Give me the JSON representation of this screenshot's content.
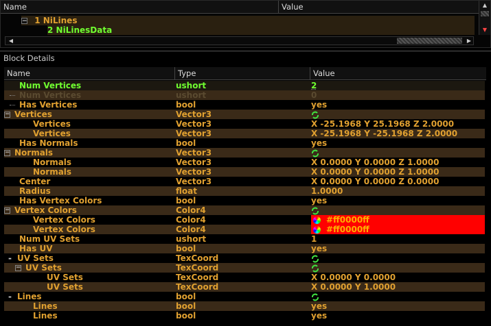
{
  "tree": {
    "header": {
      "name_col": "Name",
      "value_col": "Value"
    },
    "rows": [
      {
        "label": "1 NiLines"
      },
      {
        "label": "2 NiLinesData"
      }
    ]
  },
  "block_details": {
    "title": "Block Details",
    "columns": {
      "name": "Name",
      "type": "Type",
      "value": "Value"
    },
    "rows": [
      {
        "name": "Num Vertices",
        "type": "ushort",
        "value": "2"
      },
      {
        "name": "Num Vertices",
        "type": "ushort",
        "value": "0"
      },
      {
        "name": "Has Vertices",
        "type": "bool",
        "value": "yes"
      },
      {
        "name": "Vertices",
        "type": "Vector3",
        "value": ""
      },
      {
        "name": "Vertices",
        "type": "Vector3",
        "value": "X -25.1968 Y 25.1968 Z 2.0000"
      },
      {
        "name": "Vertices",
        "type": "Vector3",
        "value": "X -25.1968 Y -25.1968 Z 2.0000"
      },
      {
        "name": "Has Normals",
        "type": "bool",
        "value": "yes"
      },
      {
        "name": "Normals",
        "type": "Vector3",
        "value": ""
      },
      {
        "name": "Normals",
        "type": "Vector3",
        "value": "X 0.0000 Y 0.0000 Z 1.0000"
      },
      {
        "name": "Normals",
        "type": "Vector3",
        "value": "X 0.0000 Y 0.0000 Z 1.0000"
      },
      {
        "name": "Center",
        "type": "Vector3",
        "value": "X 0.0000 Y 0.0000 Z 0.0000"
      },
      {
        "name": "Radius",
        "type": "float",
        "value": "1.0000"
      },
      {
        "name": "Has Vertex Colors",
        "type": "bool",
        "value": "yes"
      },
      {
        "name": "Vertex Colors",
        "type": "Color4",
        "value": ""
      },
      {
        "name": "Vertex Colors",
        "type": "Color4",
        "value": "#ff0000ff"
      },
      {
        "name": "Vertex Colors",
        "type": "Color4",
        "value": "#ff0000ff"
      },
      {
        "name": "Num UV Sets",
        "type": "ushort",
        "value": "1"
      },
      {
        "name": "Has UV",
        "type": "bool",
        "value": "yes"
      },
      {
        "name": "UV Sets",
        "type": "TexCoord",
        "value": ""
      },
      {
        "name": "UV Sets",
        "type": "TexCoord",
        "value": ""
      },
      {
        "name": "UV Sets",
        "type": "TexCoord",
        "value": "X 0.0000 Y 0.0000"
      },
      {
        "name": "UV Sets",
        "type": "TexCoord",
        "value": "X 0.0000 Y 1.0000"
      },
      {
        "name": "Lines",
        "type": "bool",
        "value": ""
      },
      {
        "name": "Lines",
        "type": "bool",
        "value": "yes"
      },
      {
        "name": "Lines",
        "type": "bool",
        "value": "yes"
      }
    ]
  },
  "colors": {
    "text_orange": "#e0a030",
    "highlight_green": "#70ff30",
    "vertex_color_swatch": "#ff0000"
  }
}
